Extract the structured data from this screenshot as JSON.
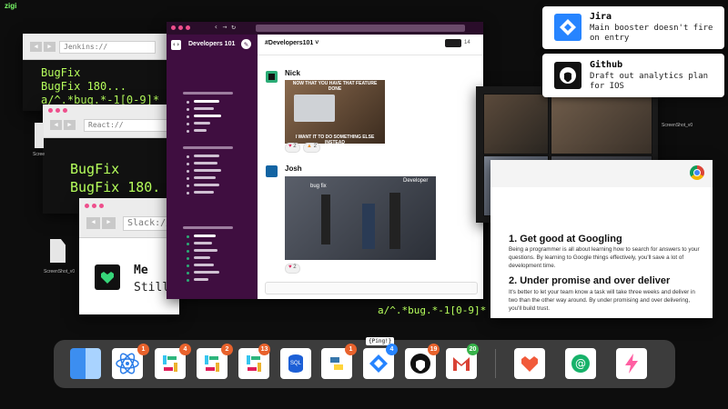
{
  "app_logo": "zigi",
  "jenkins": {
    "url": "Jenkins://",
    "lines": [
      "BugFix",
      "BugFix 180...",
      "a/^.*bug.*-1[0-9]*"
    ]
  },
  "react": {
    "url": "React://",
    "lines": [
      "BugFix",
      "BugFix 180."
    ]
  },
  "slack_small": {
    "url": "Slack://",
    "user": "Me",
    "text": "Still"
  },
  "desktop": {
    "file1": "Scree",
    "file2": "ScreenShot_v0",
    "file3": "ScreenShot_v0"
  },
  "bottom_term": "a/^.*bug.*-1[0-9]*",
  "slack": {
    "team": "Developers 101",
    "channel": "#Developers101 ˅",
    "member_count": "14",
    "messages": [
      {
        "user": "Nick",
        "meme_top": "NOW THAT YOU HAVE THAT FEATURE DONE",
        "meme_bottom": "I WANT IT TO DO SOMETHING ELSE INSTEAD",
        "reaction1": "2",
        "reaction2": "2"
      },
      {
        "user": "Josh",
        "gif_text1": "bug fix",
        "gif_text2": "Developer",
        "reaction1": "2"
      }
    ]
  },
  "notifications": [
    {
      "title": "Jira",
      "body": "Main booster doesn't fire on entry",
      "icon": "jira-icon",
      "color": "#2684ff"
    },
    {
      "title": "Github",
      "body": "Draft out analytics plan for IOS",
      "icon": "github-icon",
      "color": "#111111"
    }
  ],
  "article": {
    "section1_title": "1. Get good at Googling",
    "section1_body": "Being a programmer is all about learning how to search for answers to your questions. By learning to Google things effectively, you'll save a lot of development time.",
    "section2_title": "2. Under promise and over deliver",
    "section2_body": "It's better to let your team know a task will take three weeks and deliver in two than the other way around. By under promising and over delivering, you'll build trust."
  },
  "video_call": {
    "screenshot_label": "ScreenShot_v0"
  },
  "dock": {
    "tooltip": "{Ping!}",
    "apps": [
      {
        "name": "finder",
        "badge": ""
      },
      {
        "name": "react",
        "badge": "1"
      },
      {
        "name": "slack",
        "badge": "4"
      },
      {
        "name": "slack-2",
        "badge": "2"
      },
      {
        "name": "slack-3",
        "badge": "13"
      },
      {
        "name": "sql",
        "badge": "",
        "label": "SQL"
      },
      {
        "name": "python",
        "badge": "1"
      },
      {
        "name": "jira",
        "badge": "4"
      },
      {
        "name": "github",
        "badge": "19"
      },
      {
        "name": "gmail",
        "badge": "20"
      },
      {
        "name": "heart",
        "badge": ""
      },
      {
        "name": "at",
        "badge": ""
      },
      {
        "name": "bolt",
        "badge": ""
      }
    ]
  }
}
